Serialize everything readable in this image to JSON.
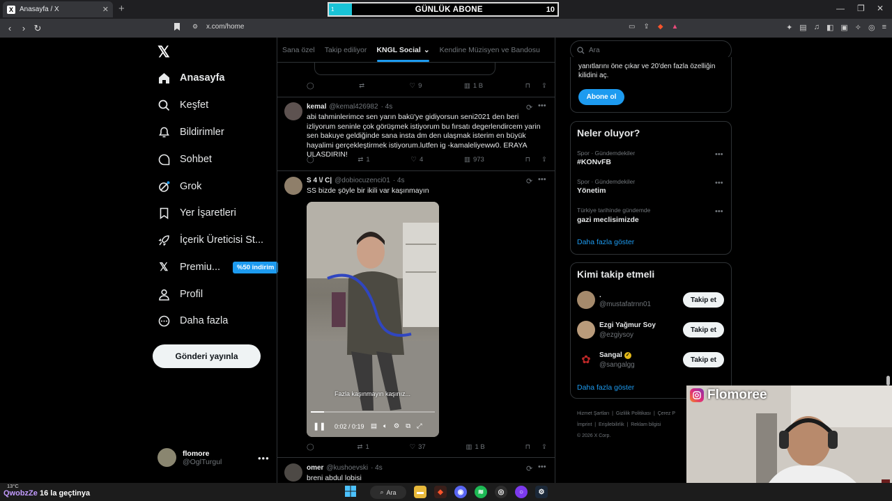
{
  "browser": {
    "tab_title": "Anasayfa / X",
    "url": "x.com/home"
  },
  "overlay": {
    "subscriber_label": "GÜNLÜK ABONE",
    "subscriber_progress_start": "1",
    "subscriber_count": "10",
    "subscriber_fill_fraction": 0.1,
    "progress_color": "#19c3d6"
  },
  "nav": {
    "items": [
      {
        "label": "Anasayfa",
        "icon": "home-icon"
      },
      {
        "label": "Keşfet",
        "icon": "search-icon"
      },
      {
        "label": "Bildirimler",
        "icon": "bell-icon"
      },
      {
        "label": "Sohbet",
        "icon": "chat-icon"
      },
      {
        "label": "Grok",
        "icon": "grok-icon"
      },
      {
        "label": "Yer İşaretleri",
        "icon": "bookmark-icon"
      },
      {
        "label": "İçerik Üreticisi St...",
        "icon": "rocket-icon"
      },
      {
        "label": "Premiu...",
        "icon": "x-logo-icon"
      },
      {
        "label": "Profil",
        "icon": "person-icon"
      },
      {
        "label": "Daha fazla",
        "icon": "more-circle-icon"
      }
    ],
    "premium_badge": "%50 indirim",
    "post_button": "Gönderi yayınla",
    "me": {
      "name": "flomore",
      "handle": "@OglTurgul"
    }
  },
  "feed": {
    "tabs": [
      "Sana özel",
      "Takip ediliyor",
      "KNGL Social",
      "Kendine Müzisyen ve Bandosu"
    ],
    "active_tab": "KNGL Social",
    "first_actions": {
      "replies": "",
      "retweets": "",
      "likes": "9",
      "views": "1 B"
    },
    "tweets": [
      {
        "name": "kemal",
        "handle": "@kemal426982",
        "time": "· 4s",
        "text": "abi tahminlerimce sen yarın bakü'ye gidiyorsun seni2021 den beri izliyorum seninle çok görüşmek istiyorum bu fırsatı degerlendircem yarin sen bakuye geldiğinde sana insta dm den ulaşmak isterim en büyük hayalimi gerçekleştirmek istiyorum.lutfen ig -kamaleliyeww0. ERAYA ULASDIRIN!",
        "replies": "",
        "retweets": "1",
        "likes": "4",
        "views": "973"
      },
      {
        "name": "S 4 \\/ C|",
        "handle": "@dobiocuzenci01",
        "time": "· 4s",
        "text": "SS bizde şöyle bir ikili var kaşınmayın",
        "video_caption": "Fazla kaşınmayın kaşınız...",
        "video_time": "0:02 / 0:19",
        "video_progress": 0.105,
        "replies": "",
        "retweets": "1",
        "likes": "37",
        "views": "1 B"
      },
      {
        "name": "omer",
        "handle": "@kushoevski",
        "time": "· 4s",
        "text": "breni abdul lobisi"
      }
    ]
  },
  "right": {
    "search_placeholder": "Ara",
    "promo_text": "yanıtlarını öne çıkar ve 20'den fazla özelliğin kilidini aç.",
    "promo_button": "Abone ol",
    "trends_title": "Neler oluyor?",
    "trends": [
      {
        "category": "Spor · Gündemdekiler",
        "name": "#KONvFB"
      },
      {
        "category": "Spor · Gündemdekiler",
        "name": "Yönetim"
      },
      {
        "category": "Türkiye tarihinde gündemde",
        "name": "gazi meclisimizde"
      }
    ],
    "trends_more": "Daha fazla göster",
    "wtf_title": "Kimi takip etmeli",
    "wtf": [
      {
        "name": ".",
        "handle": "@mustafatrnn01",
        "button": "Takip et"
      },
      {
        "name": "Ezgi Yağmur Soy",
        "handle": "@ezgiysoy",
        "button": "Takip et"
      },
      {
        "name": "Sangal",
        "handle": "@sangalgg",
        "button": "Takip et"
      }
    ],
    "wtf_more": "Daha fazla göster",
    "footer": [
      "Hizmet Şartları",
      "Gizlilik Politikası",
      "Çerez P",
      "İmprint",
      "Erişilebilirlik",
      "Reklam bilgisi",
      "© 2026 X Corp."
    ]
  },
  "webcam": {
    "name": "Flomoree"
  },
  "taskbar": {
    "weather": "13°C",
    "overlay_name": "QwobzZe",
    "overlay_text": "la geçtinya",
    "overlay_count": "16",
    "search_label": "Ara"
  }
}
